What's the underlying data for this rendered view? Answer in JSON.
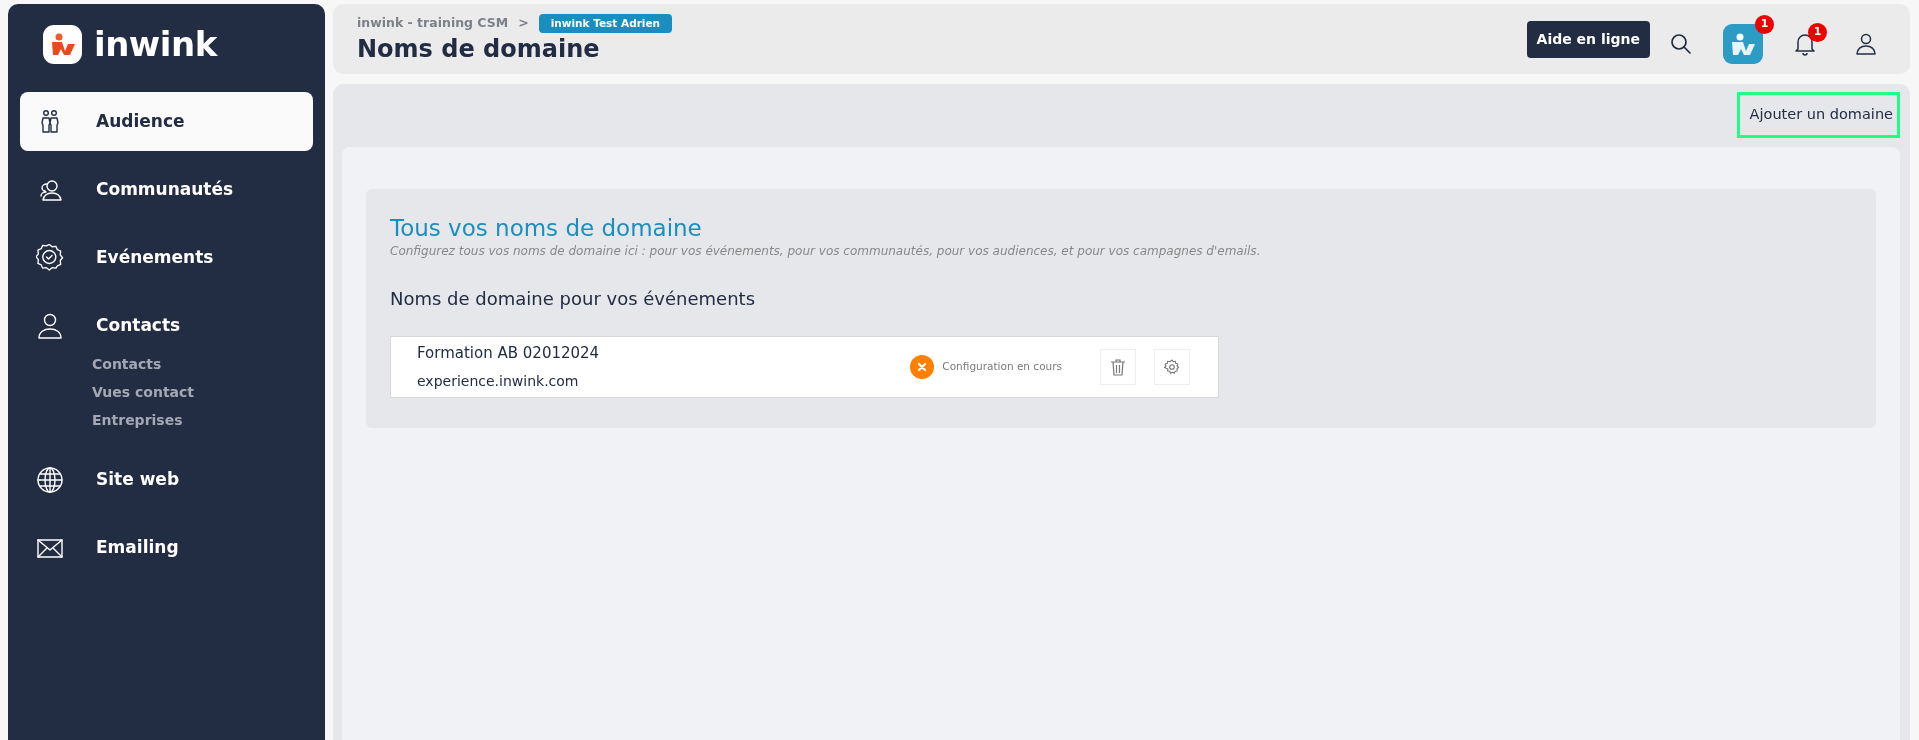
{
  "brand": {
    "name": "inwink"
  },
  "sidebar": {
    "items": [
      {
        "label": "Audience",
        "selected": true
      },
      {
        "label": "Communautés",
        "selected": false
      },
      {
        "label": "Evénements",
        "selected": false
      },
      {
        "label": "Contacts",
        "selected": false,
        "children": [
          {
            "label": "Contacts"
          },
          {
            "label": "Vues contact"
          },
          {
            "label": "Entreprises"
          }
        ]
      },
      {
        "label": "Site web",
        "selected": false
      },
      {
        "label": "Emailing",
        "selected": false
      }
    ]
  },
  "header": {
    "breadcrumb": "inwink - training CSM",
    "separator": ">",
    "tenant": "inwink Test Adrien",
    "title": "Noms de domaine",
    "help_button": "Aide en ligne",
    "app_badge": "1",
    "notifications_badge": "1"
  },
  "toolbar": {
    "add_button": "Ajouter un domaine"
  },
  "panel": {
    "title": "Tous vos noms de domaine",
    "description": "Configurez tous vos noms de domaine ici : pour vos événements, pour vos communautés, pour vos audiences, et pour vos campagnes d'emails.",
    "section": "Noms de domaine pour vos événements",
    "domains": [
      {
        "name": "Formation AB 02012024",
        "host": "experience.inwink.com",
        "status": "Configuration en cours",
        "kind": "error"
      }
    ]
  }
}
